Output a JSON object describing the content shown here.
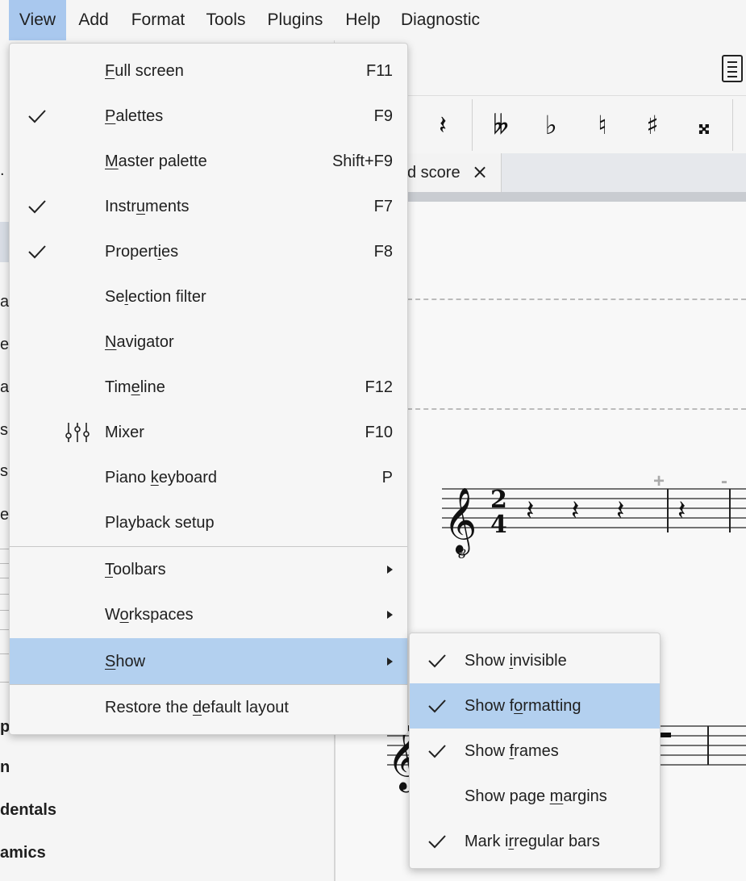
{
  "menubar": {
    "items": [
      {
        "label": "View"
      },
      {
        "label": "Add"
      },
      {
        "label": "Format"
      },
      {
        "label": "Tools"
      },
      {
        "label": "Plugins"
      },
      {
        "label": "Help"
      },
      {
        "label": "Diagnostic"
      }
    ]
  },
  "view_menu": {
    "items": [
      {
        "pre": "",
        "ul": "F",
        "post": "ull screen",
        "shortcut": "F11",
        "checked": false
      },
      {
        "pre": "",
        "ul": "P",
        "post": "alettes",
        "shortcut": "F9",
        "checked": true
      },
      {
        "pre": "",
        "ul": "M",
        "post": "aster palette",
        "shortcut": "Shift+F9",
        "checked": false
      },
      {
        "pre": "Instr",
        "ul": "u",
        "post": "ments",
        "shortcut": "F7",
        "checked": true
      },
      {
        "pre": "Propert",
        "ul": "i",
        "post": "es",
        "shortcut": "F8",
        "checked": true
      },
      {
        "pre": "Se",
        "ul": "l",
        "post": "ection filter",
        "shortcut": "",
        "checked": false
      },
      {
        "pre": "",
        "ul": "N",
        "post": "avigator",
        "shortcut": "",
        "checked": false
      },
      {
        "pre": "Tim",
        "ul": "e",
        "post": "line",
        "shortcut": "F12",
        "checked": false
      },
      {
        "pre": "Mixer",
        "ul": "",
        "post": "",
        "shortcut": "F10",
        "checked": false,
        "icon": "mixer-icon"
      },
      {
        "pre": "Piano ",
        "ul": "k",
        "post": "eyboard",
        "shortcut": "P",
        "checked": false
      },
      {
        "pre": "Playback setup",
        "ul": "",
        "post": "",
        "shortcut": "",
        "checked": false
      }
    ],
    "submenus": [
      {
        "pre": "",
        "ul": "T",
        "post": "oolbars"
      },
      {
        "pre": "W",
        "ul": "o",
        "post": "rkspaces"
      },
      {
        "pre": "",
        "ul": "S",
        "post": "how"
      }
    ],
    "restore": {
      "pre": "Restore the ",
      "ul": "d",
      "post": "efault layout"
    }
  },
  "show_menu": {
    "items": [
      {
        "pre": "Show ",
        "ul": "i",
        "post": "nvisible",
        "checked": true
      },
      {
        "pre": "Show f",
        "ul": "o",
        "post": "rmatting",
        "checked": true
      },
      {
        "pre": "Show ",
        "ul": "f",
        "post": "rames",
        "checked": true
      },
      {
        "pre": "Show page ",
        "ul": "m",
        "post": "argins",
        "checked": false
      },
      {
        "pre": "Mark i",
        "ul": "r",
        "post": "regular bars",
        "checked": true
      }
    ]
  },
  "score_tab": {
    "label": "d score",
    "close": "×"
  },
  "note_toolbar": {
    "rest": "𝄽",
    "double_flat": "𝄫",
    "flat": "♭",
    "natural": "♮",
    "sharp": "♯",
    "double_sharp": "𝄪"
  },
  "left_panel": {
    "fragments": [
      ".",
      "ar",
      "e",
      "ar",
      "s",
      "si",
      "e",
      "pe",
      "n"
    ],
    "dentals": "dentals",
    "amics": "amics"
  },
  "score": {
    "time_sig_top": "2",
    "time_sig_bottom": "4",
    "plus": "+",
    "minus": "-",
    "clef_8": "8"
  },
  "colors": {
    "highlight": "#b3d0ef",
    "active_menu": "#a9c8ee"
  }
}
